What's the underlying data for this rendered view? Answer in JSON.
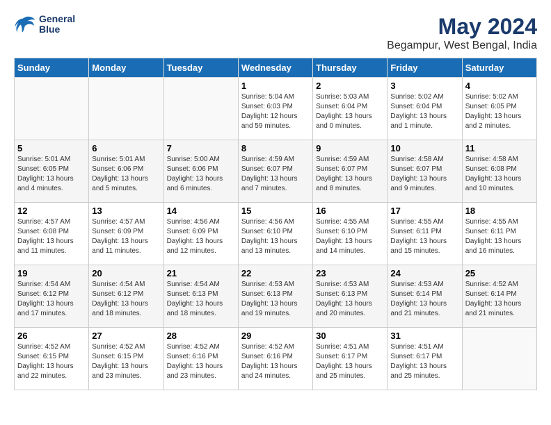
{
  "header": {
    "logo_line1": "General",
    "logo_line2": "Blue",
    "month": "May 2024",
    "location": "Begampur, West Bengal, India"
  },
  "weekdays": [
    "Sunday",
    "Monday",
    "Tuesday",
    "Wednesday",
    "Thursday",
    "Friday",
    "Saturday"
  ],
  "weeks": [
    [
      {
        "day": "",
        "info": ""
      },
      {
        "day": "",
        "info": ""
      },
      {
        "day": "",
        "info": ""
      },
      {
        "day": "1",
        "info": "Sunrise: 5:04 AM\nSunset: 6:03 PM\nDaylight: 12 hours\nand 59 minutes."
      },
      {
        "day": "2",
        "info": "Sunrise: 5:03 AM\nSunset: 6:04 PM\nDaylight: 13 hours\nand 0 minutes."
      },
      {
        "day": "3",
        "info": "Sunrise: 5:02 AM\nSunset: 6:04 PM\nDaylight: 13 hours\nand 1 minute."
      },
      {
        "day": "4",
        "info": "Sunrise: 5:02 AM\nSunset: 6:05 PM\nDaylight: 13 hours\nand 2 minutes."
      }
    ],
    [
      {
        "day": "5",
        "info": "Sunrise: 5:01 AM\nSunset: 6:05 PM\nDaylight: 13 hours\nand 4 minutes."
      },
      {
        "day": "6",
        "info": "Sunrise: 5:01 AM\nSunset: 6:06 PM\nDaylight: 13 hours\nand 5 minutes."
      },
      {
        "day": "7",
        "info": "Sunrise: 5:00 AM\nSunset: 6:06 PM\nDaylight: 13 hours\nand 6 minutes."
      },
      {
        "day": "8",
        "info": "Sunrise: 4:59 AM\nSunset: 6:07 PM\nDaylight: 13 hours\nand 7 minutes."
      },
      {
        "day": "9",
        "info": "Sunrise: 4:59 AM\nSunset: 6:07 PM\nDaylight: 13 hours\nand 8 minutes."
      },
      {
        "day": "10",
        "info": "Sunrise: 4:58 AM\nSunset: 6:07 PM\nDaylight: 13 hours\nand 9 minutes."
      },
      {
        "day": "11",
        "info": "Sunrise: 4:58 AM\nSunset: 6:08 PM\nDaylight: 13 hours\nand 10 minutes."
      }
    ],
    [
      {
        "day": "12",
        "info": "Sunrise: 4:57 AM\nSunset: 6:08 PM\nDaylight: 13 hours\nand 11 minutes."
      },
      {
        "day": "13",
        "info": "Sunrise: 4:57 AM\nSunset: 6:09 PM\nDaylight: 13 hours\nand 11 minutes."
      },
      {
        "day": "14",
        "info": "Sunrise: 4:56 AM\nSunset: 6:09 PM\nDaylight: 13 hours\nand 12 minutes."
      },
      {
        "day": "15",
        "info": "Sunrise: 4:56 AM\nSunset: 6:10 PM\nDaylight: 13 hours\nand 13 minutes."
      },
      {
        "day": "16",
        "info": "Sunrise: 4:55 AM\nSunset: 6:10 PM\nDaylight: 13 hours\nand 14 minutes."
      },
      {
        "day": "17",
        "info": "Sunrise: 4:55 AM\nSunset: 6:11 PM\nDaylight: 13 hours\nand 15 minutes."
      },
      {
        "day": "18",
        "info": "Sunrise: 4:55 AM\nSunset: 6:11 PM\nDaylight: 13 hours\nand 16 minutes."
      }
    ],
    [
      {
        "day": "19",
        "info": "Sunrise: 4:54 AM\nSunset: 6:12 PM\nDaylight: 13 hours\nand 17 minutes."
      },
      {
        "day": "20",
        "info": "Sunrise: 4:54 AM\nSunset: 6:12 PM\nDaylight: 13 hours\nand 18 minutes."
      },
      {
        "day": "21",
        "info": "Sunrise: 4:54 AM\nSunset: 6:13 PM\nDaylight: 13 hours\nand 18 minutes."
      },
      {
        "day": "22",
        "info": "Sunrise: 4:53 AM\nSunset: 6:13 PM\nDaylight: 13 hours\nand 19 minutes."
      },
      {
        "day": "23",
        "info": "Sunrise: 4:53 AM\nSunset: 6:13 PM\nDaylight: 13 hours\nand 20 minutes."
      },
      {
        "day": "24",
        "info": "Sunrise: 4:53 AM\nSunset: 6:14 PM\nDaylight: 13 hours\nand 21 minutes."
      },
      {
        "day": "25",
        "info": "Sunrise: 4:52 AM\nSunset: 6:14 PM\nDaylight: 13 hours\nand 21 minutes."
      }
    ],
    [
      {
        "day": "26",
        "info": "Sunrise: 4:52 AM\nSunset: 6:15 PM\nDaylight: 13 hours\nand 22 minutes."
      },
      {
        "day": "27",
        "info": "Sunrise: 4:52 AM\nSunset: 6:15 PM\nDaylight: 13 hours\nand 23 minutes."
      },
      {
        "day": "28",
        "info": "Sunrise: 4:52 AM\nSunset: 6:16 PM\nDaylight: 13 hours\nand 23 minutes."
      },
      {
        "day": "29",
        "info": "Sunrise: 4:52 AM\nSunset: 6:16 PM\nDaylight: 13 hours\nand 24 minutes."
      },
      {
        "day": "30",
        "info": "Sunrise: 4:51 AM\nSunset: 6:17 PM\nDaylight: 13 hours\nand 25 minutes."
      },
      {
        "day": "31",
        "info": "Sunrise: 4:51 AM\nSunset: 6:17 PM\nDaylight: 13 hours\nand 25 minutes."
      },
      {
        "day": "",
        "info": ""
      }
    ]
  ]
}
